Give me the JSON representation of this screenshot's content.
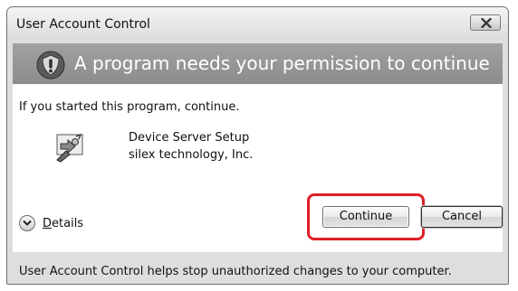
{
  "window": {
    "title": "User Account Control"
  },
  "banner": {
    "heading": "A program needs your permission to continue"
  },
  "content": {
    "instruction": "If you started this program, continue.",
    "program_name": "Device Server Setup",
    "publisher": "silex technology, Inc."
  },
  "details": {
    "label_underlined": "D",
    "label_rest": "etails"
  },
  "buttons": {
    "continue_label": "Continue",
    "cancel_label": "Cancel"
  },
  "footer": {
    "text": "User Account Control helps stop unauthorized changes to your computer."
  },
  "colors": {
    "highlight": "#e01e26",
    "banner": "#969696"
  },
  "icons": {
    "close": "close-icon",
    "shield": "shield-warning-icon",
    "program": "device-server-setup-icon",
    "details": "chevron-down-icon"
  }
}
